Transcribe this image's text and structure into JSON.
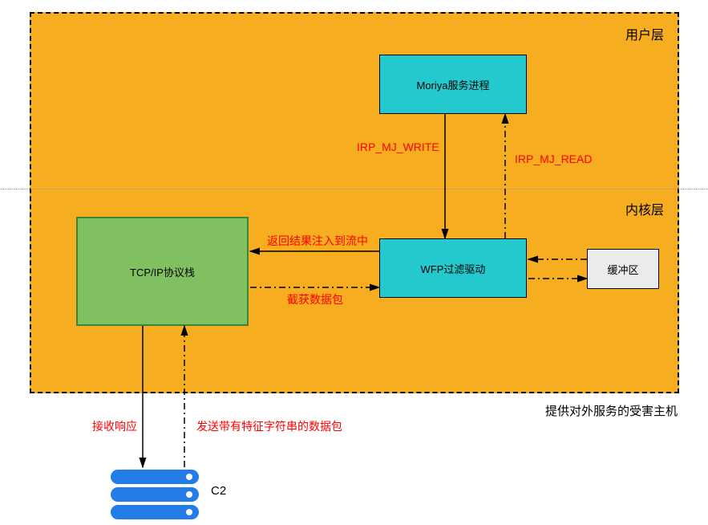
{
  "diagram": {
    "container_label_top": "用户层",
    "container_label_bottom": "内核层",
    "host_caption": "提供对外服务的受害主机",
    "boxes": {
      "moriya": "Moriya服务进程",
      "tcpip": "TCP/IP协议栈",
      "wfp": "WFP过滤驱动",
      "buffer": "缓冲区"
    },
    "edges": {
      "irp_write": "IRP_MJ_WRITE",
      "irp_read": "IRP_MJ_READ",
      "inject_result": "返回结果注入到流中",
      "capture_packet": "截获数据包",
      "recv_response": "接收响应",
      "send_packet": "发送带有特征字符串的数据包"
    },
    "c2_label": "C2"
  }
}
